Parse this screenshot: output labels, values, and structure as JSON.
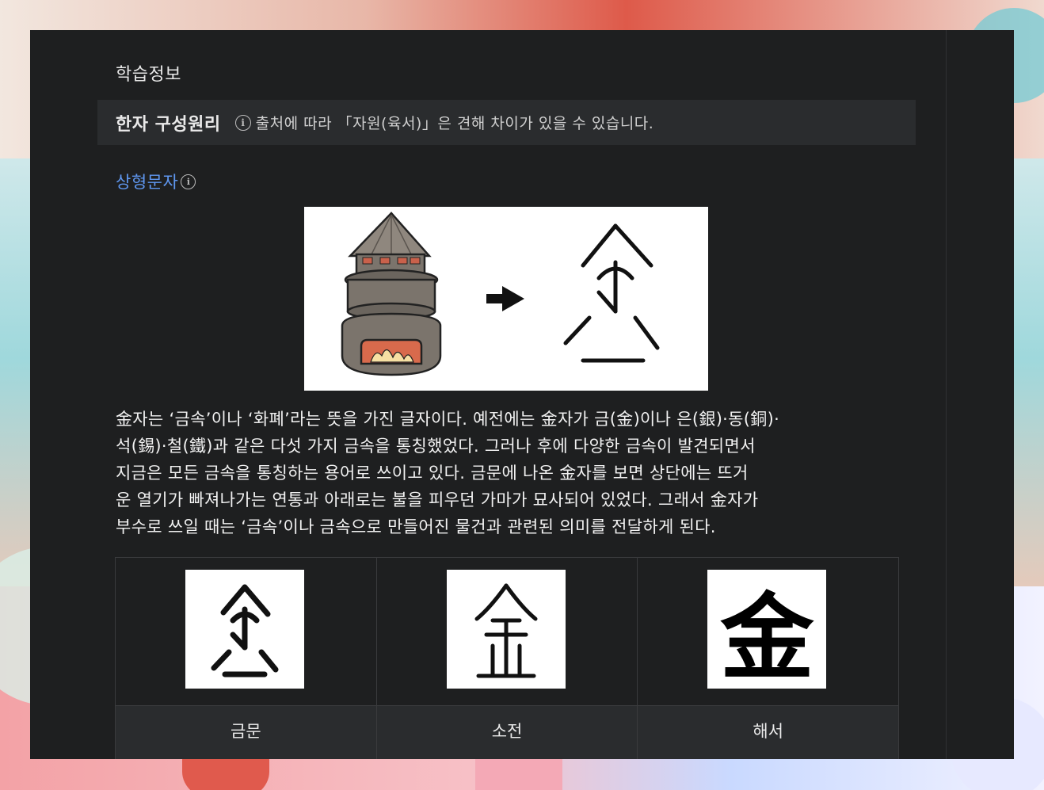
{
  "section_title": "학습정보",
  "composition": {
    "label": "한자 구성원리",
    "info_icon": "info-icon",
    "note": "출처에 따라 「자원(육서)」은 견해 차이가 있을 수 있습니다."
  },
  "category": {
    "label": "상형문자",
    "info_icon": "info-icon"
  },
  "illustration": {
    "arrow_icon": "arrow-right-icon"
  },
  "description": [
    "金자는 ‘금속’이나 ‘화폐’라는 뜻을 가진 글자이다. 예전에는 金자가 금(金)이나 은(銀)·동(銅)·",
    "석(錫)·철(鐵)과 같은 다섯 가지 금속을 통칭했었다. 그러나 후에 다양한 금속이 발견되면서",
    "지금은 모든 금속을 통칭하는 용어로 쓰이고 있다. 금문에 나온 金자를 보면 상단에는 뜨거",
    "운 열기가 빠져나가는 연통과 아래로는 불을 피우던 가마가 묘사되어 있었다. 그래서 金자가",
    "부수로 쓰일 때는 ‘금속’이나 금속으로 만들어진 물건과 관련된 의미를 전달하게 된다."
  ],
  "scripts": [
    {
      "label": "금문"
    },
    {
      "label": "소전"
    },
    {
      "label": "해서",
      "glyph": "金"
    }
  ]
}
